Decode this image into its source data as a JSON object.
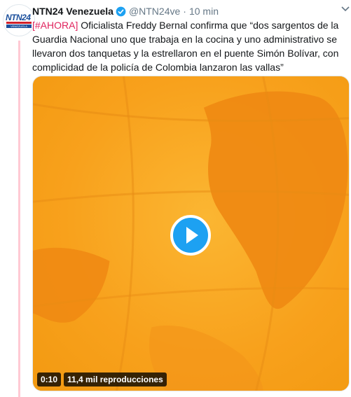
{
  "tweet": {
    "author_name": "NTN24 Venezuela",
    "author_handle": "@NTN24ve",
    "separator": "·",
    "time": "10 min",
    "hashtag": "[#AHORA]",
    "text": " Oficialista Freddy Bernal confirma que “dos sargentos de la Guardia Nacional uno que trabaja en la cocina y uno administrativo se llevaron dos tanquetas y la estrellaron en el puente Simón Bolívar, con complicidad de la policía de Colombia lanzaron las vallas”"
  },
  "avatar": {
    "logo_text": "NTN24",
    "sub_text": "VENEZUELA"
  },
  "video": {
    "duration": "0:10",
    "views": "11,4 mil reproducciones",
    "play_icon": "play-icon"
  },
  "colors": {
    "hashtag": "#e0245e",
    "verified": "#1da1f2",
    "media_bg": "#f7a21a",
    "thread_line": "#ffcad4"
  }
}
